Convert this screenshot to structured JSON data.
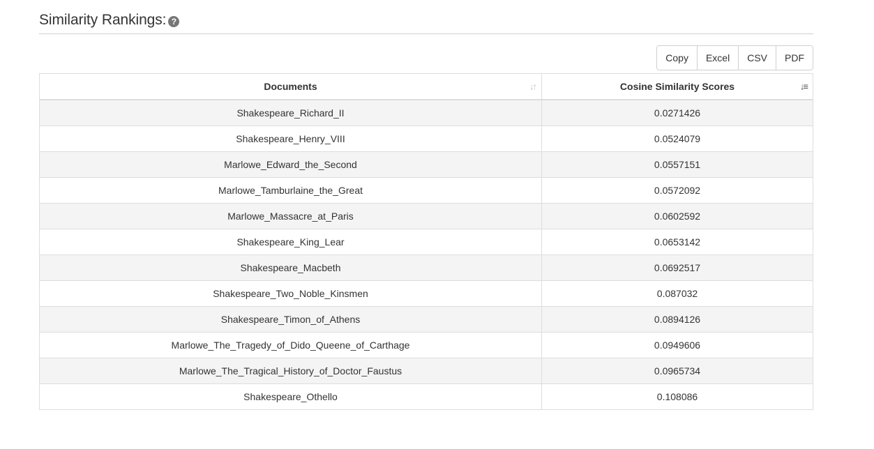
{
  "header": {
    "title": "Similarity Rankings:",
    "help_icon": "question-circle-icon"
  },
  "toolbar": {
    "copy_label": "Copy",
    "excel_label": "Excel",
    "csv_label": "CSV",
    "pdf_label": "PDF"
  },
  "table": {
    "columns": [
      {
        "label": "Documents",
        "sort_icon": "sort-icon"
      },
      {
        "label": "Cosine Similarity Scores",
        "sort_icon": "sort-ascending-icon"
      }
    ],
    "rows": [
      {
        "document": "Shakespeare_Richard_II",
        "score": "0.0271426"
      },
      {
        "document": "Shakespeare_Henry_VIII",
        "score": "0.0524079"
      },
      {
        "document": "Marlowe_Edward_the_Second",
        "score": "0.0557151"
      },
      {
        "document": "Marlowe_Tamburlaine_the_Great",
        "score": "0.0572092"
      },
      {
        "document": "Marlowe_Massacre_at_Paris",
        "score": "0.0602592"
      },
      {
        "document": "Shakespeare_King_Lear",
        "score": "0.0653142"
      },
      {
        "document": "Shakespeare_Macbeth",
        "score": "0.0692517"
      },
      {
        "document": "Shakespeare_Two_Noble_Kinsmen",
        "score": "0.087032"
      },
      {
        "document": "Shakespeare_Timon_of_Athens",
        "score": "0.0894126"
      },
      {
        "document": "Marlowe_The_Tragedy_of_Dido_Queene_of_Carthage",
        "score": "0.0949606"
      },
      {
        "document": "Marlowe_The_Tragical_History_of_Doctor_Faustus",
        "score": "0.0965734"
      },
      {
        "document": "Shakespeare_Othello",
        "score": "0.108086"
      }
    ]
  }
}
